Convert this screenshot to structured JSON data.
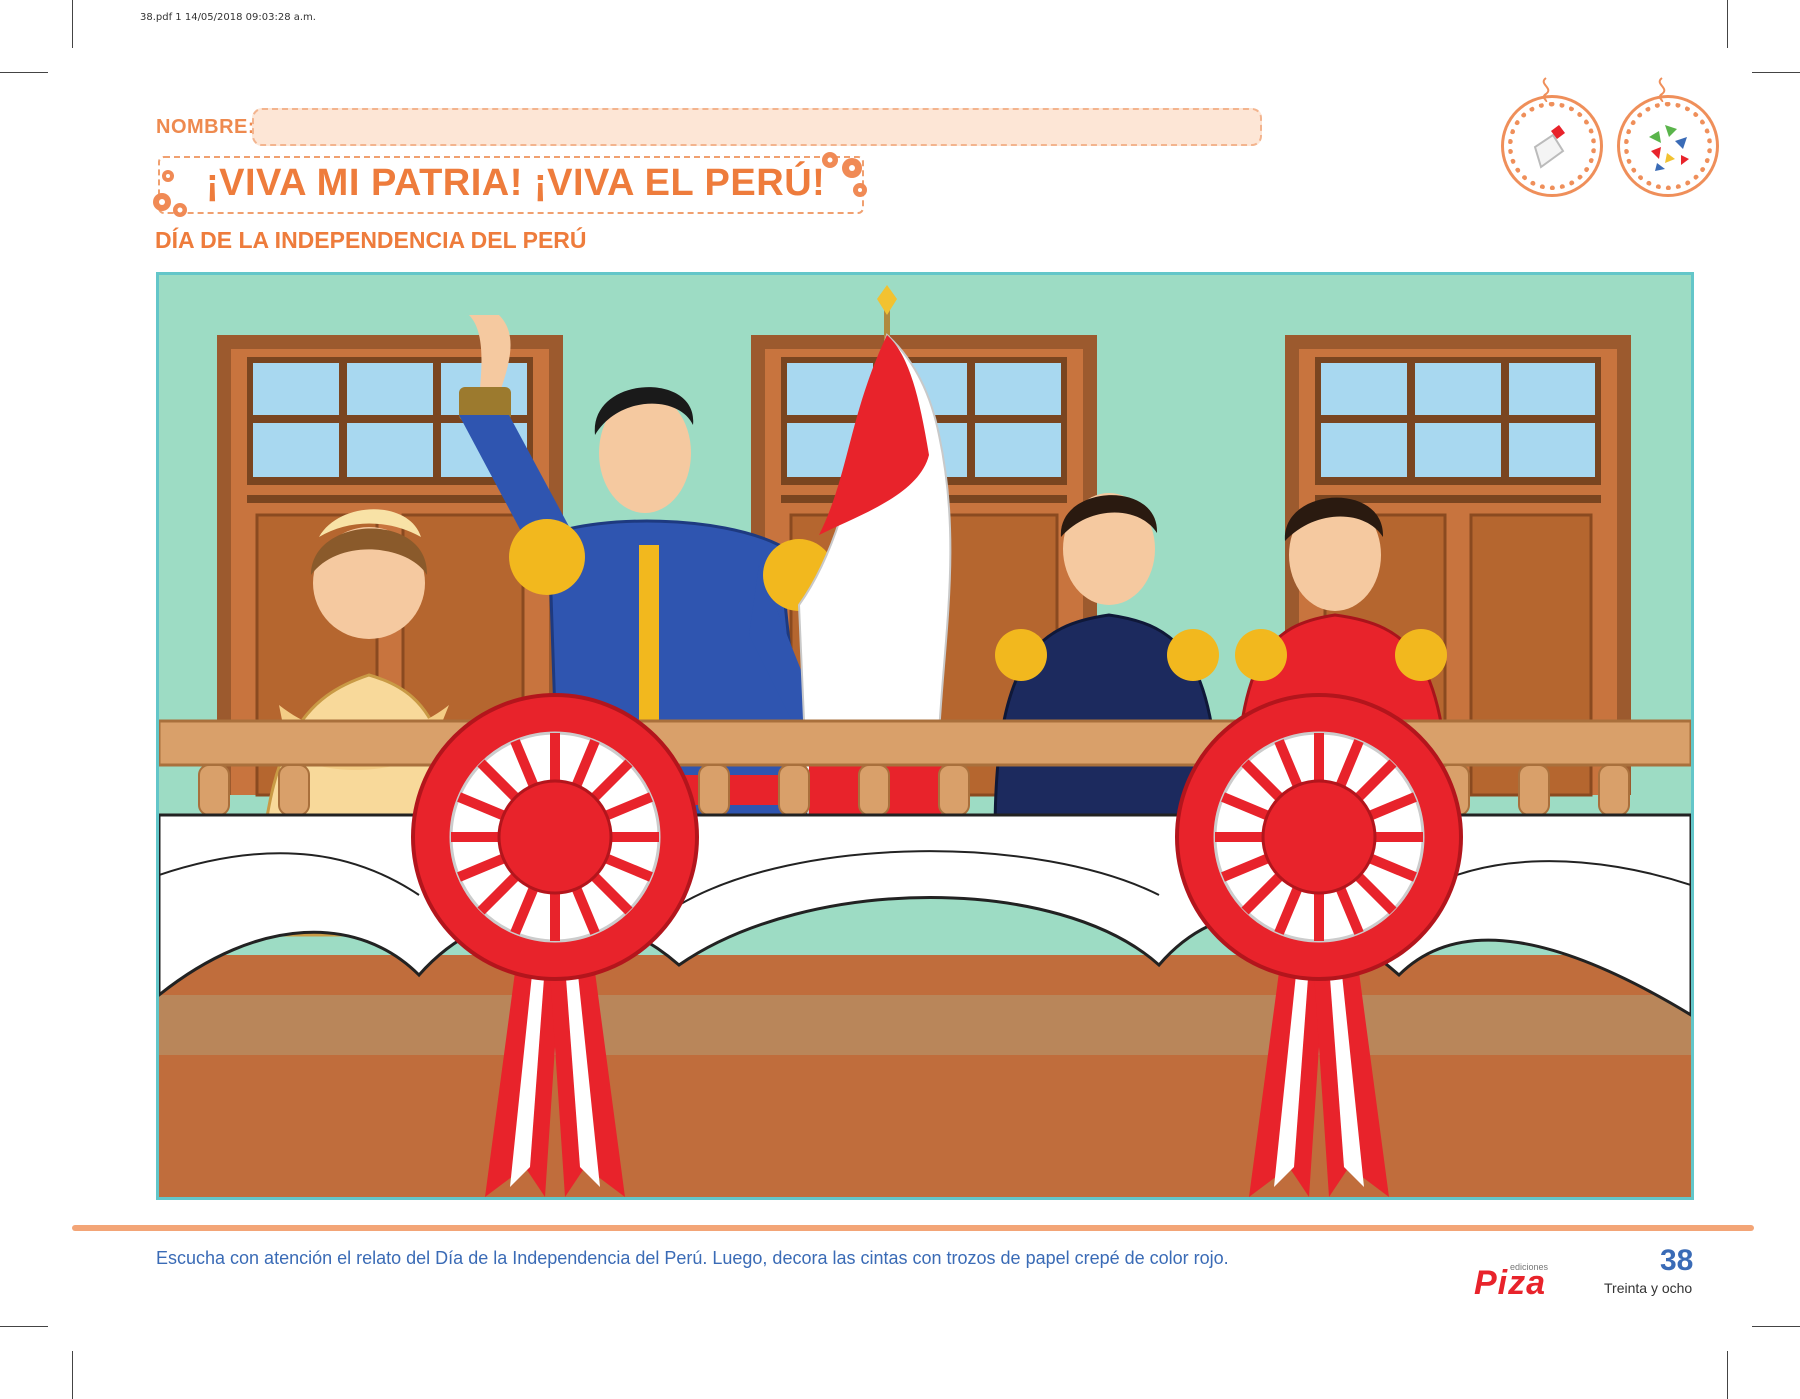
{
  "print_info": "38.pdf   1   14/05/2018   09:03:28 a.m.",
  "header": {
    "name_label": "NOMBRE:",
    "title": "¡VIVA MI PATRIA! ¡VIVA EL PERÚ!",
    "subtitle": "DÍA DE LA INDEPENDENCIA DEL PERÚ"
  },
  "badges": [
    {
      "icon": "glue-bottle-icon"
    },
    {
      "icon": "paper-pieces-icon"
    }
  ],
  "colors": {
    "accent_orange": "#ee7c3c",
    "scene_border": "#63c6c9",
    "peru_red": "#e8232b",
    "text_blue": "#3a6bb6"
  },
  "footer": {
    "instruction": "Escucha con atención el relato del Día de la Independencia del Perú. Luego, decora las cintas con trozos de papel crepé de color rojo.",
    "logo_small": "ediciones",
    "logo": "Piza",
    "page_number": "38",
    "page_words": "Treinta y ocho"
  }
}
